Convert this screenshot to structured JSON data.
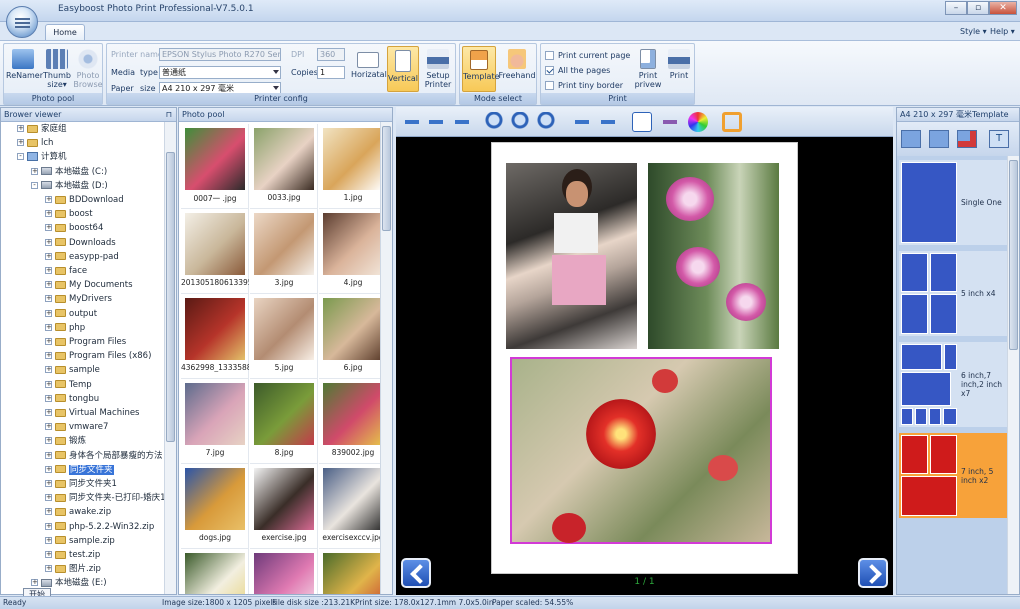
{
  "window": {
    "title": "Easyboost Photo Print Professional-V7.5.0.1",
    "controls": [
      "–",
      "▫",
      "✕"
    ]
  },
  "ribbon": {
    "tab": "Home",
    "right_menu": [
      "Style ▾",
      "Help ▾"
    ],
    "photo_pool": {
      "label": "Photo pool",
      "buttons": [
        "ReNamer",
        "Thumb size▾",
        "Photo Browse"
      ]
    },
    "printer_config": {
      "label": "Printer config",
      "printer_name_label": "Printer name",
      "printer_name_value": "EPSON Stylus Photo R270 Series",
      "dpi_label": "DPI",
      "dpi_value": "360",
      "media_label": "Media",
      "type_label": "type",
      "type_value": "普通纸",
      "copies_label": "Copies",
      "copies_value": "1",
      "paper_label": "Paper",
      "size_label": "size",
      "size_value": "A4 210 x 297 毫米",
      "buttons": [
        "Horizatal",
        "Vertical",
        "Setup Printer"
      ]
    },
    "mode_select": {
      "label": "Mode select",
      "buttons": [
        "Template",
        "Freehand"
      ]
    },
    "print": {
      "label": "Print",
      "checkboxes": [
        {
          "label": "Print current page",
          "checked": false
        },
        {
          "label": "All the pages",
          "checked": true
        },
        {
          "label": "Print tiny border",
          "checked": false
        }
      ],
      "buttons": [
        "Print privew",
        "Print"
      ]
    }
  },
  "browser": {
    "title": "Brower viewer",
    "pin": "⊓",
    "tree": [
      {
        "label": "家庭组",
        "level": 0,
        "icon": "folder",
        "exp": "+"
      },
      {
        "label": "lch",
        "level": 0,
        "icon": "folder",
        "exp": "+"
      },
      {
        "label": "计算机",
        "level": 0,
        "icon": "pc",
        "exp": "-"
      },
      {
        "label": "本地磁盘 (C:)",
        "level": 1,
        "icon": "drive",
        "exp": "+"
      },
      {
        "label": "本地磁盘 (D:)",
        "level": 1,
        "icon": "drive",
        "exp": "-"
      },
      {
        "label": "BDDownload",
        "level": 2,
        "icon": "folder",
        "exp": "+"
      },
      {
        "label": "boost",
        "level": 2,
        "icon": "folder",
        "exp": "+"
      },
      {
        "label": "boost64",
        "level": 2,
        "icon": "folder",
        "exp": "+"
      },
      {
        "label": "Downloads",
        "level": 2,
        "icon": "folder",
        "exp": "+"
      },
      {
        "label": "easypp-pad",
        "level": 2,
        "icon": "folder",
        "exp": "+"
      },
      {
        "label": "face",
        "level": 2,
        "icon": "folder",
        "exp": "+"
      },
      {
        "label": "My Documents",
        "level": 2,
        "icon": "folder",
        "exp": "+"
      },
      {
        "label": "MyDrivers",
        "level": 2,
        "icon": "folder",
        "exp": "+"
      },
      {
        "label": "output",
        "level": 2,
        "icon": "folder",
        "exp": "+"
      },
      {
        "label": "php",
        "level": 2,
        "icon": "folder",
        "exp": "+"
      },
      {
        "label": "Program Files",
        "level": 2,
        "icon": "folder",
        "exp": "+"
      },
      {
        "label": "Program Files (x86)",
        "level": 2,
        "icon": "folder",
        "exp": "+"
      },
      {
        "label": "sample",
        "level": 2,
        "icon": "folder",
        "exp": "+"
      },
      {
        "label": "Temp",
        "level": 2,
        "icon": "folder",
        "exp": "+"
      },
      {
        "label": "tongbu",
        "level": 2,
        "icon": "folder",
        "exp": "+"
      },
      {
        "label": "Virtual Machines",
        "level": 2,
        "icon": "folder",
        "exp": "+"
      },
      {
        "label": "vmware7",
        "level": 2,
        "icon": "folder",
        "exp": "+"
      },
      {
        "label": "锻炼",
        "level": 2,
        "icon": "folder",
        "exp": "+"
      },
      {
        "label": "身体各个局部暴瘦的方法",
        "level": 2,
        "icon": "folder",
        "exp": "+"
      },
      {
        "label": "同步文件夹",
        "level": 2,
        "icon": "folder",
        "exp": "+",
        "selected": true
      },
      {
        "label": "同步文件夹1",
        "level": 2,
        "icon": "folder",
        "exp": "+"
      },
      {
        "label": "同步文件夹-已打印-婚庆1",
        "level": 2,
        "icon": "folder",
        "exp": "+"
      },
      {
        "label": "awake.zip",
        "level": 2,
        "icon": "folder",
        "exp": "+"
      },
      {
        "label": "php-5.2.2-Win32.zip",
        "level": 2,
        "icon": "folder",
        "exp": "+"
      },
      {
        "label": "sample.zip",
        "level": 2,
        "icon": "folder",
        "exp": "+"
      },
      {
        "label": "test.zip",
        "level": 2,
        "icon": "folder",
        "exp": "+"
      },
      {
        "label": "图片.zip",
        "level": 2,
        "icon": "folder",
        "exp": "+"
      },
      {
        "label": "本地磁盘 (E:)",
        "level": 1,
        "icon": "drive",
        "exp": "+"
      }
    ],
    "start_tooltip": "开始"
  },
  "photo_pool": {
    "title": "Photo pool",
    "thumbs": [
      {
        "caption": "0007一 .jpg",
        "colors": [
          "#3e8f3a",
          "#d84e6e",
          "#2b2b2b"
        ]
      },
      {
        "caption": "0033.jpg",
        "colors": [
          "#8aa26a",
          "#e8d2c4",
          "#3a2b22"
        ]
      },
      {
        "caption": "1.jpg",
        "colors": [
          "#f1e3c2",
          "#d9a55a",
          "#ffffff"
        ]
      },
      {
        "caption": "201305180613395...",
        "colors": [
          "#f3efe6",
          "#c9b79a",
          "#8a5a3a"
        ]
      },
      {
        "caption": "3.jpg",
        "colors": [
          "#ecd8c6",
          "#c39873",
          "#f5f0ea"
        ]
      },
      {
        "caption": "4.jpg",
        "colors": [
          "#5b3d30",
          "#dab39a",
          "#f2e6da"
        ]
      },
      {
        "caption": "4362998_1333588...",
        "colors": [
          "#5a1a14",
          "#b6342a",
          "#e3c16a"
        ]
      },
      {
        "caption": "5.jpg",
        "colors": [
          "#e9d4c2",
          "#b38c72",
          "#f8efe6"
        ]
      },
      {
        "caption": "6.jpg",
        "colors": [
          "#7a9a4e",
          "#d7b89a",
          "#5a3b2a"
        ]
      },
      {
        "caption": "7.jpg",
        "colors": [
          "#5d6b8c",
          "#d9a4b8",
          "#e7d2c4"
        ]
      },
      {
        "caption": "8.jpg",
        "colors": [
          "#3c5a2a",
          "#7a9c3a",
          "#c43a4a"
        ]
      },
      {
        "caption": "839002.jpg",
        "colors": [
          "#4f7a34",
          "#d04a6a",
          "#e6c44a"
        ]
      },
      {
        "caption": "dogs.jpg",
        "colors": [
          "#2b55a8",
          "#d89a3a",
          "#e9c068"
        ]
      },
      {
        "caption": "exercise.jpg",
        "colors": [
          "#f3f3f3",
          "#3a2e28",
          "#d86a94"
        ]
      },
      {
        "caption": "exercisexccv.jpg",
        "colors": [
          "#4a5f86",
          "#e9e4de",
          "#2a2a2a"
        ]
      },
      {
        "caption": "",
        "colors": [
          "#3a5a2a",
          "#f2efe0",
          "#e7d27a"
        ]
      },
      {
        "caption": "",
        "colors": [
          "#6e3a7a",
          "#e07ab2",
          "#f6e6ee"
        ]
      },
      {
        "caption": "",
        "colors": [
          "#4a6b2a",
          "#e0b44a",
          "#c43a2a"
        ]
      }
    ]
  },
  "preview": {
    "toolbar_icons": [
      "undo-icon",
      "fit-width-icon",
      "redo-icon",
      "zoom-in-icon",
      "zoom-actual-icon",
      "zoom-out-icon",
      "resize-horizontal-icon",
      "move-icon",
      "text-icon",
      "cut-icon",
      "color-icon",
      "frame-icon"
    ],
    "page_counter": "1 / 1"
  },
  "template": {
    "title": "A4 210 x 297 毫米Template",
    "items": [
      {
        "label": "Single One",
        "selected": false
      },
      {
        "label": "5 inch x4",
        "selected": false
      },
      {
        "label": "6 inch,7 inch,2 inch x7",
        "selected": false
      },
      {
        "label": "7 inch, 5 inch x2",
        "selected": true
      }
    ]
  },
  "status": {
    "ready": "Ready",
    "image_size": "Image size:1800 x 1205 pixels",
    "file_size": "File disk size :213.21K",
    "print_size": "Print size: 178.0x127.1mm  7.0x5.0in",
    "paper_scaled": "Paper scaled: 54.55%"
  },
  "colors": {
    "accent": "#3874d8",
    "template_selected": "#f7a23a",
    "template_cell": "#3657c4",
    "template_cell_selected": "#cf1b1b",
    "page_counter": "#2da83c"
  }
}
